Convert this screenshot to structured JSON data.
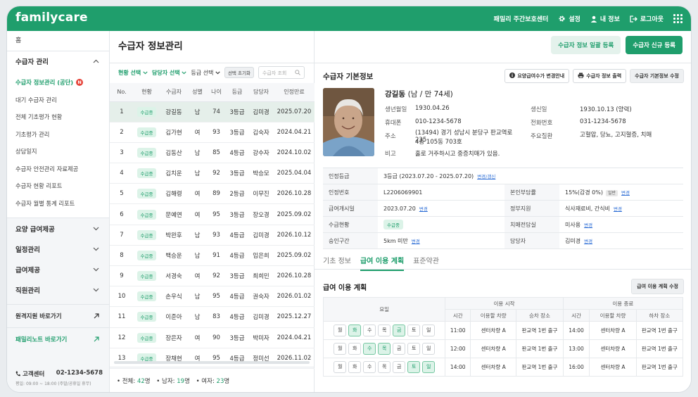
{
  "app": {
    "logo": "familycare",
    "center": "패밀리 주간보호센터",
    "nav": [
      {
        "label": "설정",
        "icon": "gear-icon"
      },
      {
        "label": "내 정보",
        "icon": "user-icon"
      },
      {
        "label": "로그아웃",
        "icon": "logout-icon"
      }
    ]
  },
  "sidebar": {
    "home": "홈",
    "group": "수급자 관리",
    "sub_items": [
      "수급자 정보관리 (공단)",
      "대기 수급자 관리",
      "전체 기초평가 현황",
      "기초평가 관리",
      "상담일지",
      "수급자 안전관리 자료제공",
      "수급자 현황 리포트",
      "수급자 월별 통계 리포트"
    ],
    "badge": "N",
    "menu": [
      "요양 급여제공",
      "일정관리",
      "급여제공",
      "직원관리"
    ],
    "links": [
      "원격지원 바로가기",
      "패밀리노트 바로가기"
    ],
    "contact_label": "고객센터",
    "contact_phone": "02-1234-5678",
    "hours": "평일: 09:00 ~ 18:00 (주말/공휴일 휴무)"
  },
  "list": {
    "title": "수급자 정보관리",
    "filters": [
      "현황 선택",
      "담당자 선택",
      "등급 선택"
    ],
    "reset": "선택 초기화",
    "search_placeholder": "수급자 조회",
    "headers": [
      "No.",
      "현황",
      "수급자",
      "성별",
      "나이",
      "등급",
      "담당자",
      "인정만료"
    ],
    "rows": [
      [
        "1",
        "수급중",
        "강길동",
        "남",
        "74",
        "3등급",
        "김미경",
        "2025.07.20"
      ],
      [
        "2",
        "수급중",
        "김가현",
        "여",
        "93",
        "3등급",
        "김숙자",
        "2024.04.21"
      ],
      [
        "3",
        "수급중",
        "김동산",
        "남",
        "85",
        "4등급",
        "강수자",
        "2024.10.02"
      ],
      [
        "4",
        "수급중",
        "김치운",
        "남",
        "92",
        "3등급",
        "박승모",
        "2025.04.04"
      ],
      [
        "5",
        "수급중",
        "김해령",
        "여",
        "89",
        "2등급",
        "이무진",
        "2026.10.28"
      ],
      [
        "6",
        "수급중",
        "문예연",
        "여",
        "95",
        "3등급",
        "장오경",
        "2025.09.02"
      ],
      [
        "7",
        "수급중",
        "박완후",
        "남",
        "93",
        "4등급",
        "김미경",
        "2026.10.12"
      ],
      [
        "8",
        "수급중",
        "백승운",
        "남",
        "91",
        "4등급",
        "임은희",
        "2025.09.02"
      ],
      [
        "9",
        "수급중",
        "서경숙",
        "여",
        "92",
        "3등급",
        "최희민",
        "2026.10.28"
      ],
      [
        "10",
        "수급중",
        "손우식",
        "남",
        "95",
        "4등급",
        "권숙자",
        "2026.01.02"
      ],
      [
        "11",
        "수급중",
        "이준아",
        "남",
        "83",
        "4등급",
        "김미경",
        "2025.12.27"
      ],
      [
        "12",
        "수급중",
        "장은자",
        "여",
        "90",
        "3등급",
        "박미자",
        "2024.04.21"
      ],
      [
        "13",
        "수급중",
        "장채현",
        "여",
        "95",
        "4등급",
        "정미선",
        "2026.11.02"
      ]
    ],
    "footer": {
      "total_label": "• 전체:",
      "total": "42",
      "unit": "명",
      "male_label": "• 남자:",
      "male": "19",
      "female_label": "• 여자:",
      "female": "23"
    }
  },
  "detail": {
    "btn_bulk": "수급자 정보 일괄 등록",
    "btn_new": "수급자 신규 등록",
    "section_title": "수급자 기본정보",
    "btn_notice": "요양급여수가 변경안내",
    "btn_print": "수급자 정보 출력",
    "btn_edit": "수급자 기본정보 수정",
    "name": "강길동",
    "name_sub": "(남 / 만 74세)",
    "fields": {
      "birth_k": "생년월일",
      "birth": "1930.04.26",
      "lunar_k": "생신일",
      "lunar": "1930.10.13 (양력)",
      "mobile_k": "휴대폰",
      "mobile": "010-1234-5678",
      "tel_k": "전화번호",
      "tel": "031-1234-5678",
      "addr_k": "주소",
      "addr1": "(13494) 경기 성남시 분당구 판교역로 235",
      "addr2": "4층 105동 703호",
      "disease_k": "주요질환",
      "disease": "고혈압, 당뇨, 고지혈증, 치매",
      "note_k": "비고",
      "note": "홀로 거주하시고 중증치매가 있음."
    },
    "grid": {
      "grade_k": "인정등급",
      "grade": "3등급 (2023.07.20 - 2025.07.20)",
      "grade_link": "변경/갱신",
      "no_k": "인정번호",
      "no": "L2206069901",
      "copay_k": "본인부담률",
      "copay": "15%(감경 0%)",
      "copay_badge": "일반",
      "copay_link": "변경",
      "start_k": "급여개시일",
      "start": "2023.07.20",
      "start_link": "변경",
      "support_k": "정부지원",
      "support": "식사재료비, 간식비",
      "support_link": "변경",
      "status_k": "수급현황",
      "status": "수급중",
      "dementia_k": "치매전담실",
      "dementia": "미사용",
      "dementia_link": "변경",
      "range_k": "승인구간",
      "range": "5km 미만",
      "range_link": "변경",
      "manager_k": "담당자",
      "manager": "김미경",
      "manager_link": "변경"
    },
    "tabs": [
      "기초 정보",
      "급여 이용 계획",
      "표준약관"
    ],
    "plan_title": "급여 이용 계획",
    "plan_edit": "급여 이용 계획 수정",
    "plan_head": {
      "day": "요일",
      "use_start": "이용 시작",
      "use_end": "이용 종료",
      "time": "시간",
      "vehicle": "이용할 차량",
      "pickup": "승차 장소",
      "dropoff": "하차 장소"
    },
    "weekdays": [
      "월",
      "화",
      "수",
      "목",
      "금",
      "토",
      "일"
    ],
    "plans": [
      {
        "on": [
          false,
          true,
          false,
          false,
          true,
          false,
          false
        ],
        "st": "11:00",
        "sv": "센터차량 A",
        "sp": "판교역 1번 출구",
        "et": "14:00",
        "ev": "센터차량 A",
        "ep": "판교역 1번 출구"
      },
      {
        "on": [
          false,
          false,
          true,
          true,
          false,
          false,
          false
        ],
        "st": "12:00",
        "sv": "센터차량 A",
        "sp": "판교역 1번 출구",
        "et": "13:00",
        "ev": "센터차량 A",
        "ep": "판교역 1번 출구"
      },
      {
        "on": [
          false,
          false,
          false,
          false,
          false,
          true,
          true
        ],
        "st": "14:00",
        "sv": "센터차량 A",
        "sp": "판교역 1번 출구",
        "et": "16:00",
        "ev": "센터차량 A",
        "ep": "판교역 1번 출구"
      }
    ]
  }
}
